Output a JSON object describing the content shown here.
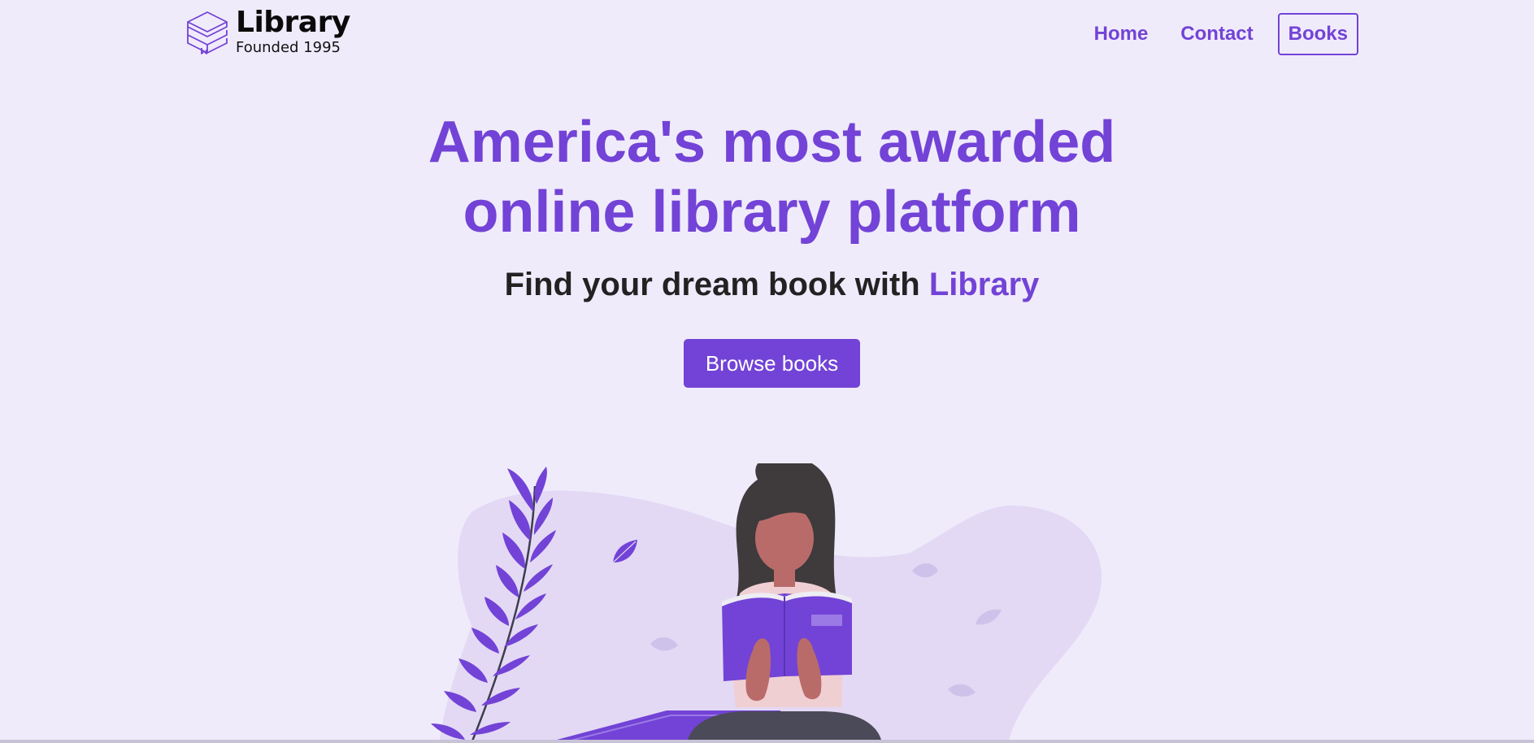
{
  "header": {
    "logo": {
      "title": "Library",
      "subtitle": "Founded 1995",
      "icon": "stacked-books-icon"
    },
    "nav": [
      {
        "label": "Home",
        "active": false
      },
      {
        "label": "Contact",
        "active": false
      },
      {
        "label": "Books",
        "active": true
      }
    ]
  },
  "hero": {
    "title_line1": "America's most awarded",
    "title_line2": "online library platform",
    "subtitle_prefix": "Find your dream book with ",
    "subtitle_accent": "Library",
    "cta_label": "Browse books",
    "illustration": "woman-reading-book-illustration"
  },
  "colors": {
    "accent": "#7243d6",
    "background": "#f0ebfb",
    "blob": "#e3d9f5",
    "text_dark": "#222222"
  }
}
